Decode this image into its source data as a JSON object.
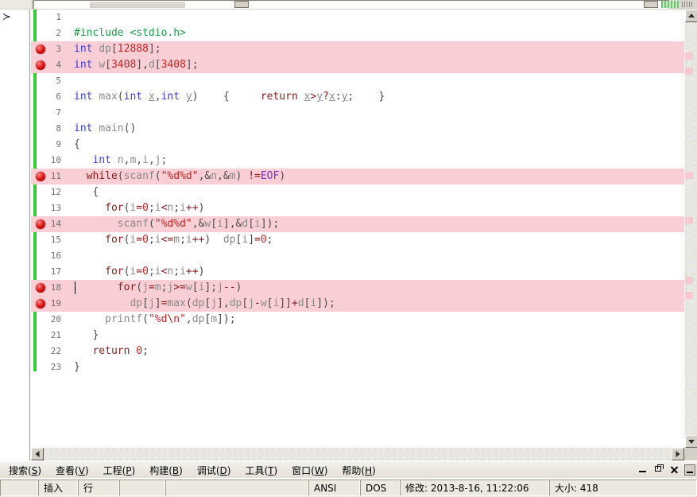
{
  "window": {
    "title": "",
    "controls": {
      "minimize": "minimize-button",
      "restore": "restore-button",
      "close": "close-button",
      "extra": "panel-toggle-button"
    }
  },
  "left_panel": {
    "expand_icon": "chevron-right-icon",
    "expand_glyph": "≻"
  },
  "editor": {
    "total_lines": 23,
    "caret_line": 18,
    "breakpoint_lines": [
      3,
      4,
      11,
      14,
      18,
      19
    ],
    "highlighted_lines": [
      3,
      4,
      11,
      14,
      18,
      19
    ],
    "colors": {
      "highlight_bg": "#f9ced4",
      "change_bar": "#33cc33",
      "breakpoint": "#e01b1b",
      "preprocessor": "#1f9b4b",
      "keyword": "#8b1a1a",
      "type": "#3a3ae0",
      "identifier": "#8a8a8a",
      "number": "#cc2222",
      "string": "#cc2222",
      "macro": "#7a2fd6",
      "punctuation": "#4a4a4a"
    },
    "lines": [
      {
        "n": 1,
        "tokens": []
      },
      {
        "n": 2,
        "tokens": [
          {
            "t": "pre",
            "v": "#include <stdio.h>"
          }
        ]
      },
      {
        "n": 3,
        "tokens": [
          {
            "t": "type",
            "v": "int"
          },
          {
            "t": "punc",
            "v": " "
          },
          {
            "t": "id",
            "v": "dp"
          },
          {
            "t": "punc",
            "v": "["
          },
          {
            "t": "num",
            "v": "12888"
          },
          {
            "t": "punc",
            "v": "];"
          }
        ]
      },
      {
        "n": 4,
        "tokens": [
          {
            "t": "type",
            "v": "int"
          },
          {
            "t": "punc",
            "v": " "
          },
          {
            "t": "id",
            "v": "w"
          },
          {
            "t": "punc",
            "v": "["
          },
          {
            "t": "num",
            "v": "3408"
          },
          {
            "t": "punc",
            "v": "],"
          },
          {
            "t": "id",
            "v": "d"
          },
          {
            "t": "punc",
            "v": "["
          },
          {
            "t": "num",
            "v": "3408"
          },
          {
            "t": "punc",
            "v": "];"
          }
        ]
      },
      {
        "n": 5,
        "tokens": []
      },
      {
        "n": 6,
        "tokens": [
          {
            "t": "type",
            "v": "int"
          },
          {
            "t": "punc",
            "v": " "
          },
          {
            "t": "fn",
            "v": "max"
          },
          {
            "t": "punc",
            "v": "("
          },
          {
            "t": "type",
            "v": "int"
          },
          {
            "t": "punc",
            "v": " "
          },
          {
            "t": "idu",
            "v": "x"
          },
          {
            "t": "punc",
            "v": ","
          },
          {
            "t": "type",
            "v": "int"
          },
          {
            "t": "punc",
            "v": " "
          },
          {
            "t": "idu",
            "v": "y"
          },
          {
            "t": "punc",
            "v": ")    {     "
          },
          {
            "t": "kw",
            "v": "return"
          },
          {
            "t": "punc",
            "v": " "
          },
          {
            "t": "idu",
            "v": "x"
          },
          {
            "t": "op",
            "v": ">"
          },
          {
            "t": "idu",
            "v": "y"
          },
          {
            "t": "op",
            "v": "?"
          },
          {
            "t": "idu",
            "v": "x"
          },
          {
            "t": "op",
            "v": ":"
          },
          {
            "t": "idu",
            "v": "y"
          },
          {
            "t": "punc",
            "v": ";    }"
          }
        ]
      },
      {
        "n": 7,
        "tokens": []
      },
      {
        "n": 8,
        "tokens": [
          {
            "t": "type",
            "v": "int"
          },
          {
            "t": "punc",
            "v": " "
          },
          {
            "t": "fn",
            "v": "main"
          },
          {
            "t": "punc",
            "v": "()"
          }
        ]
      },
      {
        "n": 9,
        "tokens": [
          {
            "t": "punc",
            "v": "{"
          }
        ]
      },
      {
        "n": 10,
        "tokens": [
          {
            "t": "punc",
            "v": "   "
          },
          {
            "t": "type",
            "v": "int"
          },
          {
            "t": "punc",
            "v": " "
          },
          {
            "t": "id",
            "v": "n"
          },
          {
            "t": "punc",
            "v": ","
          },
          {
            "t": "id",
            "v": "m"
          },
          {
            "t": "punc",
            "v": ","
          },
          {
            "t": "id",
            "v": "i"
          },
          {
            "t": "punc",
            "v": ","
          },
          {
            "t": "id",
            "v": "j"
          },
          {
            "t": "punc",
            "v": ";"
          }
        ]
      },
      {
        "n": 11,
        "tokens": [
          {
            "t": "punc",
            "v": "  "
          },
          {
            "t": "kw",
            "v": "while"
          },
          {
            "t": "punc",
            "v": "("
          },
          {
            "t": "fn",
            "v": "scanf"
          },
          {
            "t": "punc",
            "v": "("
          },
          {
            "t": "str",
            "v": "\"%d%d\""
          },
          {
            "t": "punc",
            "v": ",&"
          },
          {
            "t": "id",
            "v": "n"
          },
          {
            "t": "punc",
            "v": ",&"
          },
          {
            "t": "id",
            "v": "m"
          },
          {
            "t": "punc",
            "v": ") "
          },
          {
            "t": "op",
            "v": "!="
          },
          {
            "t": "macro",
            "v": "EOF"
          },
          {
            "t": "punc",
            "v": ")"
          }
        ]
      },
      {
        "n": 12,
        "tokens": [
          {
            "t": "punc",
            "v": "   {"
          }
        ]
      },
      {
        "n": 13,
        "tokens": [
          {
            "t": "punc",
            "v": "     "
          },
          {
            "t": "kw",
            "v": "for"
          },
          {
            "t": "punc",
            "v": "("
          },
          {
            "t": "id",
            "v": "i"
          },
          {
            "t": "op",
            "v": "="
          },
          {
            "t": "num",
            "v": "0"
          },
          {
            "t": "punc",
            "v": ";"
          },
          {
            "t": "id",
            "v": "i"
          },
          {
            "t": "op",
            "v": "<"
          },
          {
            "t": "id",
            "v": "n"
          },
          {
            "t": "punc",
            "v": ";"
          },
          {
            "t": "id",
            "v": "i"
          },
          {
            "t": "op",
            "v": "++"
          },
          {
            "t": "punc",
            "v": ")"
          }
        ]
      },
      {
        "n": 14,
        "tokens": [
          {
            "t": "punc",
            "v": "       "
          },
          {
            "t": "fn",
            "v": "scanf"
          },
          {
            "t": "punc",
            "v": "("
          },
          {
            "t": "str",
            "v": "\"%d%d\""
          },
          {
            "t": "punc",
            "v": ",&"
          },
          {
            "t": "id",
            "v": "w"
          },
          {
            "t": "punc",
            "v": "["
          },
          {
            "t": "id",
            "v": "i"
          },
          {
            "t": "punc",
            "v": "],&"
          },
          {
            "t": "id",
            "v": "d"
          },
          {
            "t": "punc",
            "v": "["
          },
          {
            "t": "id",
            "v": "i"
          },
          {
            "t": "punc",
            "v": "]);"
          }
        ]
      },
      {
        "n": 15,
        "tokens": [
          {
            "t": "punc",
            "v": "     "
          },
          {
            "t": "kw",
            "v": "for"
          },
          {
            "t": "punc",
            "v": "("
          },
          {
            "t": "id",
            "v": "i"
          },
          {
            "t": "op",
            "v": "="
          },
          {
            "t": "num",
            "v": "0"
          },
          {
            "t": "punc",
            "v": ";"
          },
          {
            "t": "id",
            "v": "i"
          },
          {
            "t": "op",
            "v": "<="
          },
          {
            "t": "id",
            "v": "m"
          },
          {
            "t": "punc",
            "v": ";"
          },
          {
            "t": "id",
            "v": "i"
          },
          {
            "t": "op",
            "v": "++"
          },
          {
            "t": "punc",
            "v": ")  "
          },
          {
            "t": "id",
            "v": "dp"
          },
          {
            "t": "punc",
            "v": "["
          },
          {
            "t": "id",
            "v": "i"
          },
          {
            "t": "punc",
            "v": "]"
          },
          {
            "t": "op",
            "v": "="
          },
          {
            "t": "num",
            "v": "0"
          },
          {
            "t": "punc",
            "v": ";"
          }
        ]
      },
      {
        "n": 16,
        "tokens": []
      },
      {
        "n": 17,
        "tokens": [
          {
            "t": "punc",
            "v": "     "
          },
          {
            "t": "kw",
            "v": "for"
          },
          {
            "t": "punc",
            "v": "("
          },
          {
            "t": "id",
            "v": "i"
          },
          {
            "t": "op",
            "v": "="
          },
          {
            "t": "num",
            "v": "0"
          },
          {
            "t": "punc",
            "v": ";"
          },
          {
            "t": "id",
            "v": "i"
          },
          {
            "t": "op",
            "v": "<"
          },
          {
            "t": "id",
            "v": "n"
          },
          {
            "t": "punc",
            "v": ";"
          },
          {
            "t": "id",
            "v": "i"
          },
          {
            "t": "op",
            "v": "++"
          },
          {
            "t": "punc",
            "v": ")"
          }
        ]
      },
      {
        "n": 18,
        "tokens": [
          {
            "t": "punc",
            "v": "       "
          },
          {
            "t": "kw",
            "v": "for"
          },
          {
            "t": "punc",
            "v": "("
          },
          {
            "t": "id",
            "v": "j"
          },
          {
            "t": "op",
            "v": "="
          },
          {
            "t": "id",
            "v": "m"
          },
          {
            "t": "punc",
            "v": ";"
          },
          {
            "t": "id",
            "v": "j"
          },
          {
            "t": "op",
            "v": ">="
          },
          {
            "t": "id",
            "v": "w"
          },
          {
            "t": "punc",
            "v": "["
          },
          {
            "t": "id",
            "v": "i"
          },
          {
            "t": "punc",
            "v": "];"
          },
          {
            "t": "id",
            "v": "j"
          },
          {
            "t": "op",
            "v": "--"
          },
          {
            "t": "punc",
            "v": ")"
          }
        ]
      },
      {
        "n": 19,
        "tokens": [
          {
            "t": "punc",
            "v": "         "
          },
          {
            "t": "id",
            "v": "dp"
          },
          {
            "t": "punc",
            "v": "["
          },
          {
            "t": "id",
            "v": "j"
          },
          {
            "t": "punc",
            "v": "]"
          },
          {
            "t": "op",
            "v": "="
          },
          {
            "t": "fn",
            "v": "max"
          },
          {
            "t": "punc",
            "v": "("
          },
          {
            "t": "id",
            "v": "dp"
          },
          {
            "t": "punc",
            "v": "["
          },
          {
            "t": "id",
            "v": "j"
          },
          {
            "t": "punc",
            "v": "],"
          },
          {
            "t": "id",
            "v": "dp"
          },
          {
            "t": "punc",
            "v": "["
          },
          {
            "t": "id",
            "v": "j"
          },
          {
            "t": "op",
            "v": "-"
          },
          {
            "t": "id",
            "v": "w"
          },
          {
            "t": "punc",
            "v": "["
          },
          {
            "t": "id",
            "v": "i"
          },
          {
            "t": "punc",
            "v": "]]"
          },
          {
            "t": "op",
            "v": "+"
          },
          {
            "t": "id",
            "v": "d"
          },
          {
            "t": "punc",
            "v": "["
          },
          {
            "t": "id",
            "v": "i"
          },
          {
            "t": "punc",
            "v": "]);"
          }
        ]
      },
      {
        "n": 20,
        "tokens": [
          {
            "t": "punc",
            "v": "     "
          },
          {
            "t": "fn",
            "v": "printf"
          },
          {
            "t": "punc",
            "v": "("
          },
          {
            "t": "str",
            "v": "\"%d\\n\""
          },
          {
            "t": "punc",
            "v": ","
          },
          {
            "t": "id",
            "v": "dp"
          },
          {
            "t": "punc",
            "v": "["
          },
          {
            "t": "id",
            "v": "m"
          },
          {
            "t": "punc",
            "v": "]);"
          }
        ]
      },
      {
        "n": 21,
        "tokens": [
          {
            "t": "punc",
            "v": "   }"
          }
        ]
      },
      {
        "n": 22,
        "tokens": [
          {
            "t": "punc",
            "v": "   "
          },
          {
            "t": "kw",
            "v": "return"
          },
          {
            "t": "punc",
            "v": " "
          },
          {
            "t": "num",
            "v": "0"
          },
          {
            "t": "punc",
            "v": ";"
          }
        ]
      },
      {
        "n": 23,
        "tokens": [
          {
            "t": "punc",
            "v": "}"
          }
        ]
      }
    ]
  },
  "menubar": {
    "items": [
      {
        "label": "搜索(S)",
        "key": "S",
        "name": "menu-search"
      },
      {
        "label": "查看(V)",
        "key": "V",
        "name": "menu-view"
      },
      {
        "label": "工程(P)",
        "key": "P",
        "name": "menu-project"
      },
      {
        "label": "构建(B)",
        "key": "B",
        "name": "menu-build"
      },
      {
        "label": "调试(D)",
        "key": "D",
        "name": "menu-debug"
      },
      {
        "label": "工具(T)",
        "key": "T",
        "name": "menu-tools"
      },
      {
        "label": "窗口(W)",
        "key": "W",
        "name": "menu-window"
      },
      {
        "label": "帮助(H)",
        "key": "H",
        "name": "menu-help"
      }
    ]
  },
  "statusbar": {
    "insert_mode": "插入",
    "line_label": "行",
    "field_blank_1": "",
    "field_blank_2": "",
    "encoding": "ANSI",
    "line_ending": "DOS",
    "modified": "修改: 2013-8-16, 11:22:06",
    "size": "大小: 418"
  }
}
